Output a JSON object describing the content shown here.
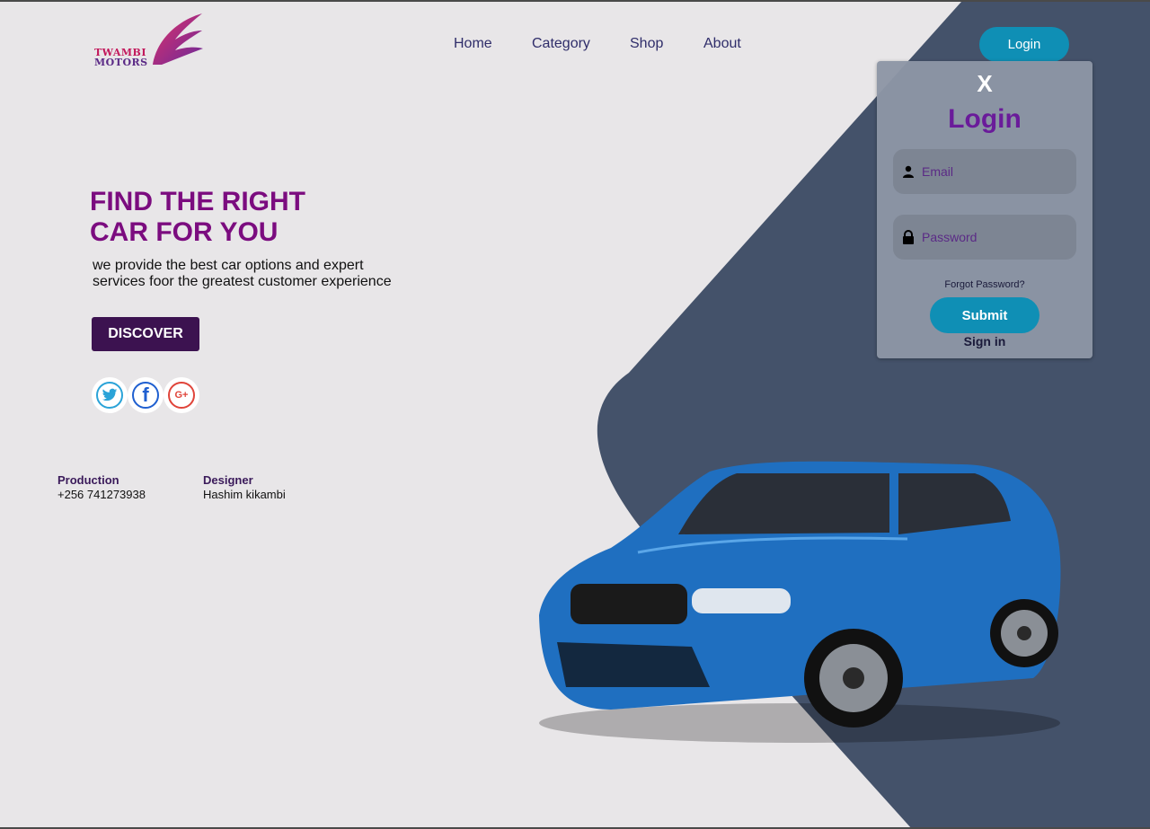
{
  "brand": {
    "line1": "TWAMBI",
    "line2": "MOTORS"
  },
  "nav": {
    "items": [
      {
        "label": "Home"
      },
      {
        "label": "Category"
      },
      {
        "label": "Shop"
      },
      {
        "label": "About"
      }
    ]
  },
  "header": {
    "login_label": "Login"
  },
  "hero": {
    "title_line1": "FIND THE RIGHT",
    "title_line2": "CAR FOR YOU",
    "subtitle_line1": "we provide the best car options and expert",
    "subtitle_line2": "services foor the greatest customer experience",
    "discover_label": "DISCOVER"
  },
  "social": {
    "icons": [
      "twitter-icon",
      "facebook-icon",
      "google-plus-icon"
    ],
    "gplus_text": "G+",
    "fb_text": "f"
  },
  "credits": {
    "production_label": "Production",
    "production_value": "+256 741273938",
    "designer_label": "Designer",
    "designer_value": "Hashim kikambi"
  },
  "login_modal": {
    "close": "X",
    "title": "Login",
    "email_placeholder": "Email",
    "password_placeholder": "Password",
    "forgot": "Forgot Password?",
    "submit": "Submit",
    "signin": "Sign in"
  },
  "colors": {
    "accent": "#0f8fb5",
    "title": "#7b0c7f",
    "dark_panel": "#44526a",
    "discover": "#3c1250",
    "car": "#1f6fc0"
  }
}
